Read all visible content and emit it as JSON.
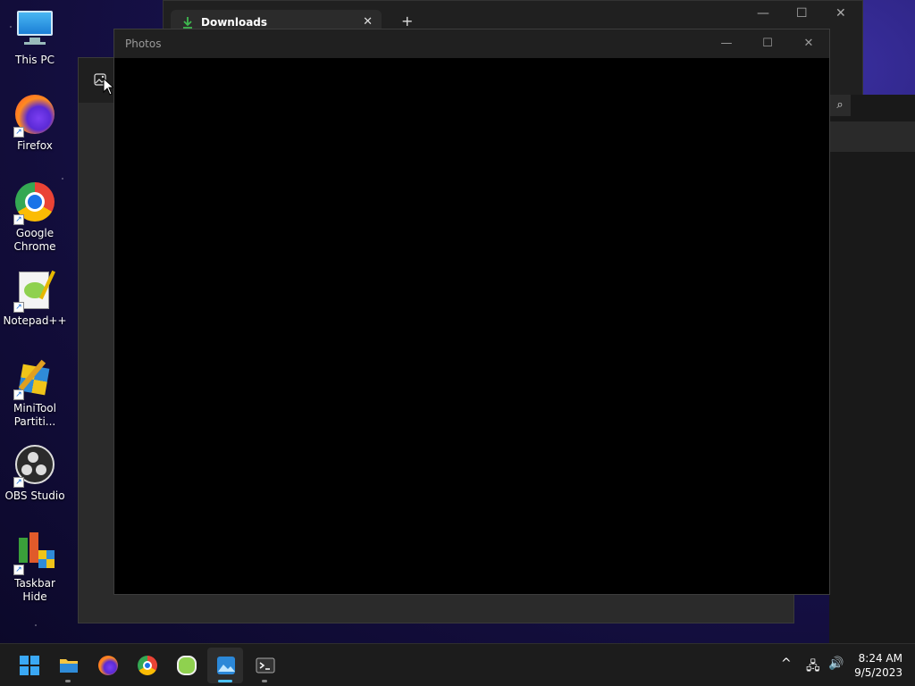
{
  "desktop": {
    "icons": [
      {
        "label": "This PC"
      },
      {
        "label": "Firefox"
      },
      {
        "label": "Google Chrome"
      },
      {
        "label": "Notepad++"
      },
      {
        "label": "MiniTool Partiti..."
      },
      {
        "label": "OBS Studio"
      },
      {
        "label": "Taskbar Hide"
      }
    ]
  },
  "downloads_window": {
    "tab_title": "Downloads",
    "close_tab": "✕",
    "new_tab": "+"
  },
  "photos_window": {
    "title": "Photos",
    "minimize": "—",
    "maximize": "☐",
    "close": "✕"
  },
  "taskbar": {
    "apps": [
      "start",
      "file-explorer",
      "firefox",
      "chrome",
      "notepad++",
      "photos",
      "terminal"
    ],
    "active_app": "photos",
    "tray": {
      "chevron": "^",
      "network": "🖧",
      "volume": "🔊"
    },
    "time": "8:24 AM",
    "date": "9/5/2023"
  },
  "colors": {
    "accent": "#4cc2ff",
    "taskbar_bg": "#1c1c1c"
  }
}
